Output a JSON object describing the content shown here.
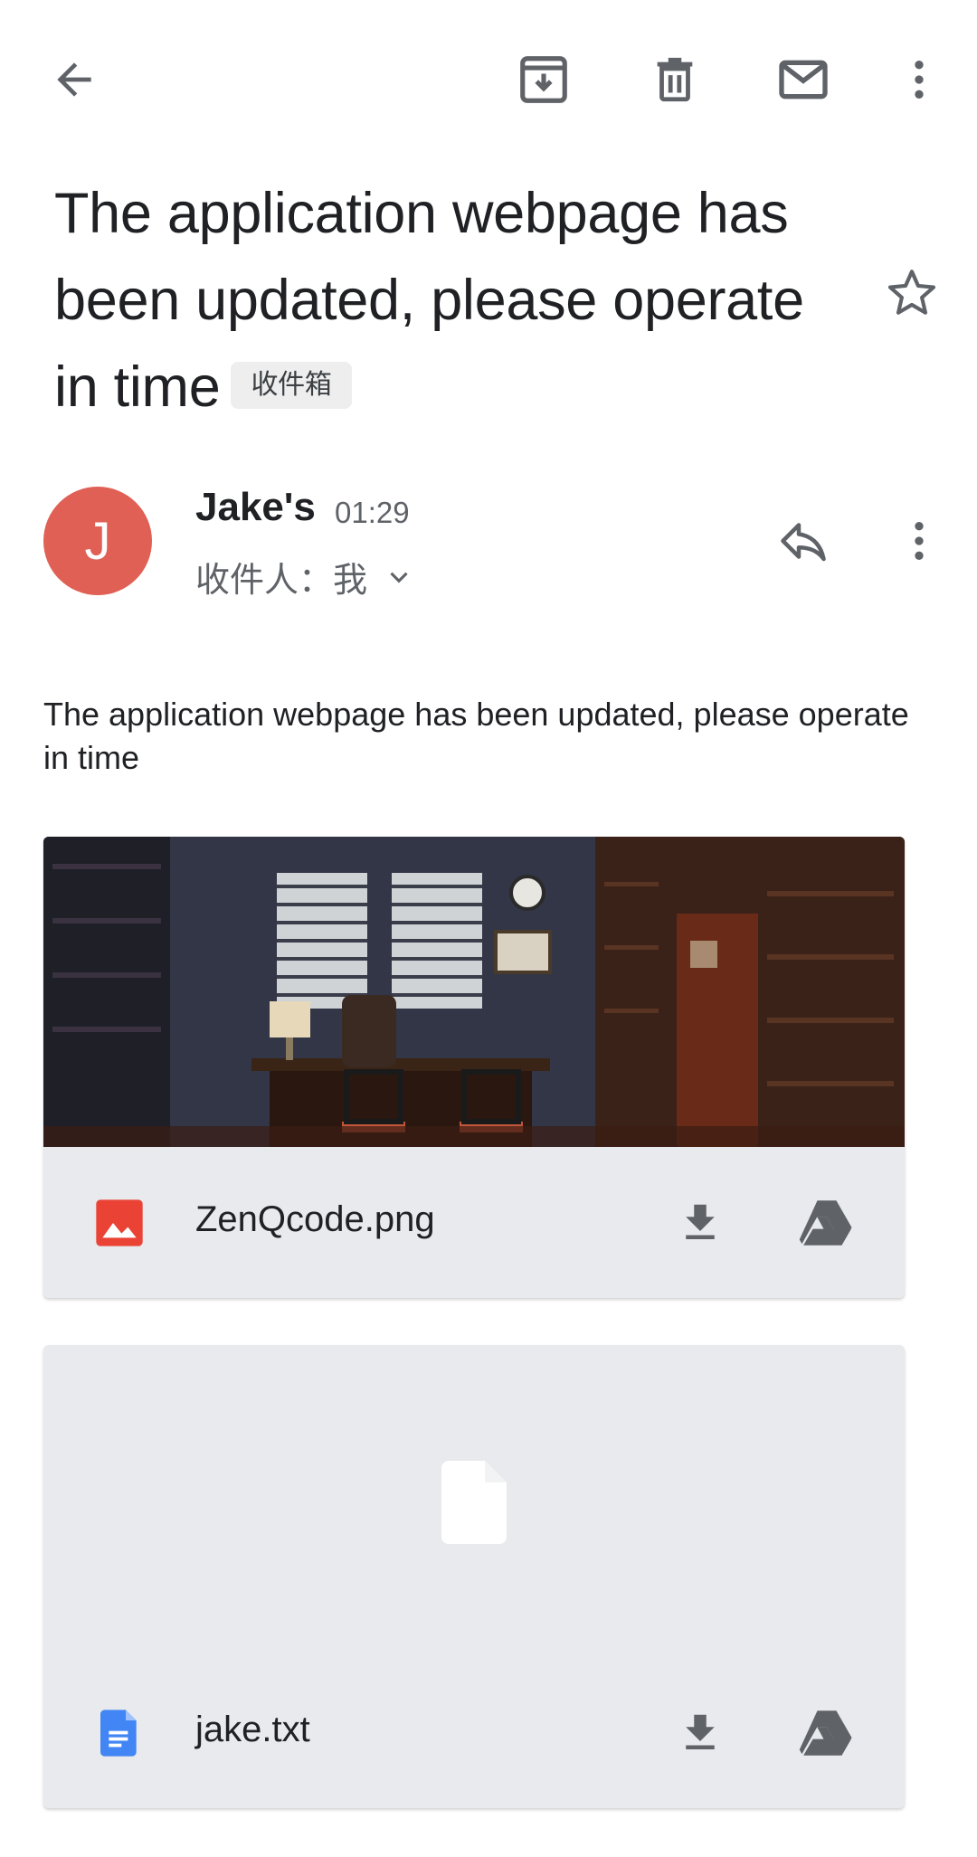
{
  "toolbar": {
    "icons": [
      "back-arrow-icon",
      "archive-icon",
      "trash-icon",
      "mail-icon",
      "more-vert-icon"
    ]
  },
  "email": {
    "subject": "The application webpage has been updated, please operate in time",
    "label": "收件箱",
    "sender": {
      "initial": "J",
      "name": "Jake's",
      "time": "01:29",
      "recipient": "收件人：我"
    },
    "body": "The application webpage has been updated, please operate in time"
  },
  "attachments": [
    {
      "name": "ZenQcode.png",
      "type": "image",
      "icon": "image-file-icon"
    },
    {
      "name": "jake.txt",
      "type": "text",
      "icon": "doc-file-icon"
    }
  ],
  "colors": {
    "avatar": "#e06055",
    "card_background": "#e8eaed",
    "image_icon": "#ea4335",
    "doc_icon": "#4285f4",
    "icon_gray": "#5f6368"
  }
}
